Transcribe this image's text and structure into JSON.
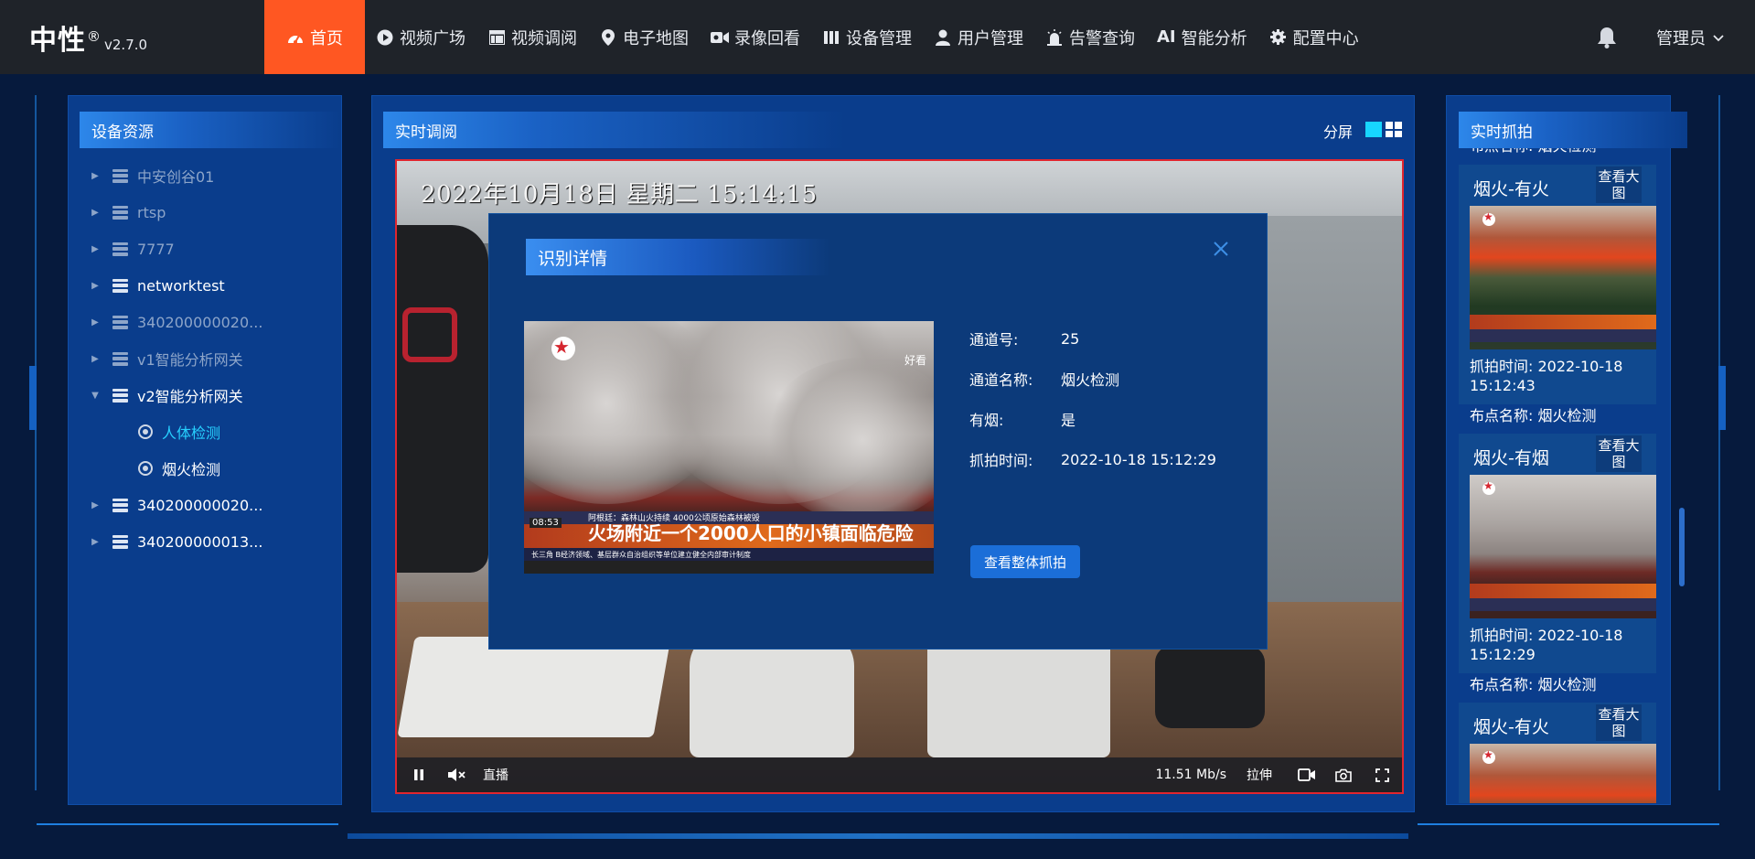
{
  "brand": {
    "name": "中性",
    "reg": "®",
    "version": "v2.7.0"
  },
  "nav": [
    {
      "label": "首页",
      "icon": "dashboard-icon",
      "active": true
    },
    {
      "label": "视频广场",
      "icon": "play-circle-icon"
    },
    {
      "label": "视频调阅",
      "icon": "table-icon"
    },
    {
      "label": "电子地图",
      "icon": "map-pin-icon"
    },
    {
      "label": "录像回看",
      "icon": "video-camera-icon"
    },
    {
      "label": "设备管理",
      "icon": "device-icon"
    },
    {
      "label": "用户管理",
      "icon": "user-icon"
    },
    {
      "label": "告警查询",
      "icon": "alarm-icon"
    },
    {
      "label": "智能分析",
      "icon": "ai-icon",
      "prefix": "AI"
    },
    {
      "label": "配置中心",
      "icon": "gear-icon"
    }
  ],
  "user": {
    "name": "管理员"
  },
  "left_panel": {
    "title": "设备资源",
    "tree": [
      {
        "label": "中安创谷01",
        "bright": false,
        "expanded": false
      },
      {
        "label": "rtsp",
        "bright": false,
        "expanded": false
      },
      {
        "label": "7777",
        "bright": false,
        "expanded": false
      },
      {
        "label": "networktest",
        "bright": true,
        "expanded": false
      },
      {
        "label": "340200000020...",
        "bright": false,
        "expanded": false
      },
      {
        "label": "v1智能分析网关",
        "bright": false,
        "expanded": false
      },
      {
        "label": "v2智能分析网关",
        "bright": true,
        "expanded": true,
        "children": [
          {
            "label": "人体检测",
            "selected": true
          },
          {
            "label": "烟火检测",
            "selected": false
          }
        ]
      },
      {
        "label": "340200000020...",
        "bright": true,
        "expanded": false
      },
      {
        "label": "340200000013...",
        "bright": true,
        "expanded": false
      }
    ]
  },
  "center_panel": {
    "title": "实时调阅",
    "split_label": "分屏",
    "osd_text": "2022年10月18日 星期二 15:14:15",
    "controls": {
      "live": "直播",
      "bitrate": "11.51 Mb/s",
      "stretch": "拉伸"
    }
  },
  "modal": {
    "title": "识别详情",
    "image": {
      "news_headline": "火场附近一个2000人口的小镇面临危险",
      "news_sub": "阿根廷：森林山火持续 4000公顷原始森林被毁",
      "news_time": "08:53",
      "news_ticker": "长三角 B经济领域、基层群众自治组织等单位建立健全内部审计制度",
      "watermark": "好看"
    },
    "fields": [
      {
        "label": "通道号:",
        "value": "25"
      },
      {
        "label": "通道名称:",
        "value": "烟火检测"
      },
      {
        "label": "有烟:",
        "value": "是"
      },
      {
        "label": "抓拍时间:",
        "value": "2022-10-18 15:12:29"
      }
    ],
    "button": "查看整体抓拍"
  },
  "right_panel": {
    "title": "实时抓拍",
    "top_partial_caption": "布点名称: 烟火检测",
    "snaps": [
      {
        "title": "烟火-有火",
        "view_label": "查看大图",
        "kind": "fire",
        "time_label": "抓拍时间:",
        "time": "2022-10-18 15:12:43",
        "site_label": "布点名称:",
        "site": "烟火检测"
      },
      {
        "title": "烟火-有烟",
        "view_label": "查看大图",
        "kind": "smoke",
        "time_label": "抓拍时间:",
        "time": "2022-10-18 15:12:29",
        "site_label": "布点名称:",
        "site": "烟火检测"
      },
      {
        "title": "烟火-有火",
        "view_label": "查看大图",
        "kind": "fire"
      }
    ]
  },
  "colors": {
    "nav_bg": "#1f2329",
    "active": "#ff5722",
    "accent": "#17d6ff",
    "panel": "#0a3d8c",
    "video_border": "#e0262f"
  }
}
